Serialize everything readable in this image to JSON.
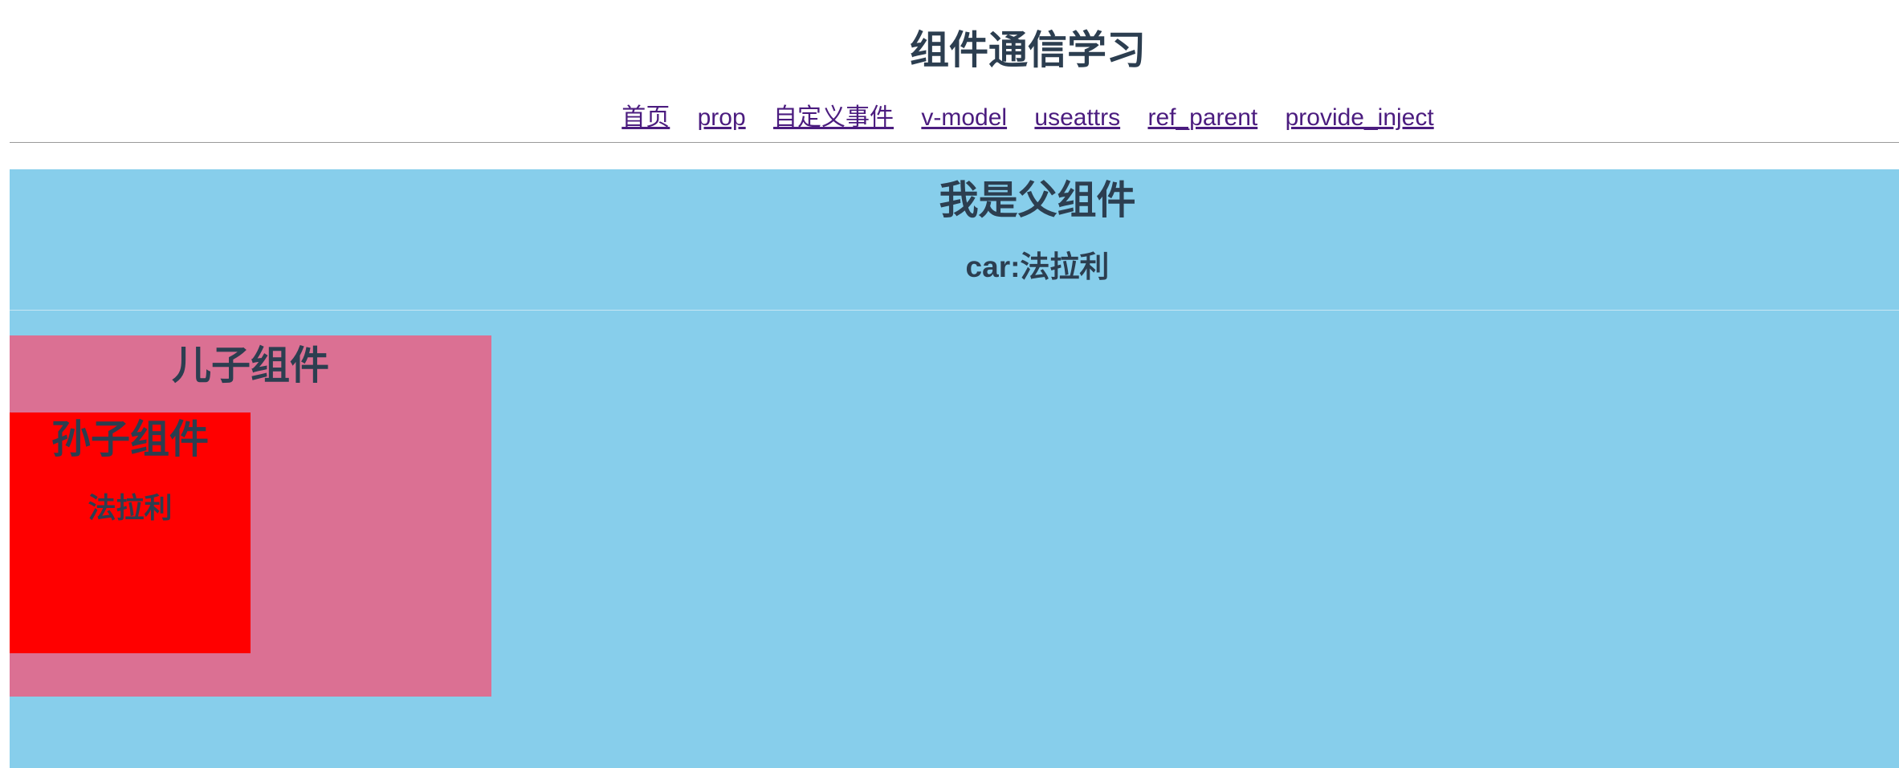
{
  "app": {
    "title": "组件通信学习"
  },
  "nav": {
    "items": [
      {
        "label": "首页"
      },
      {
        "label": "prop"
      },
      {
        "label": "自定义事件"
      },
      {
        "label": "v-model"
      },
      {
        "label": "useattrs"
      },
      {
        "label": "ref_parent"
      },
      {
        "label": "provide_inject"
      }
    ]
  },
  "parent": {
    "title": "我是父组件",
    "car_text": "car:法拉利",
    "background": "#87ceeb"
  },
  "child": {
    "title": "儿子组件",
    "background": "#db7093"
  },
  "grandchild": {
    "title": "孙子组件",
    "car_text": "法拉利",
    "background": "#ff0000"
  },
  "colors": {
    "heading_text": "#2c3e50",
    "link": "#4b1c7f"
  }
}
